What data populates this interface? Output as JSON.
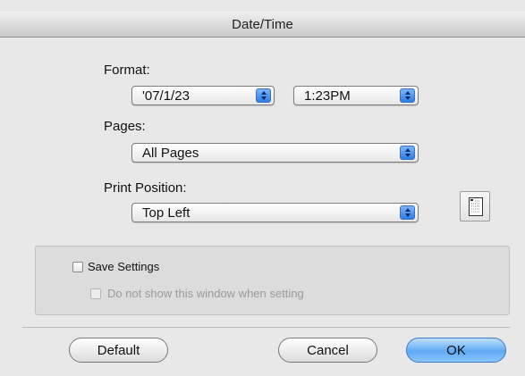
{
  "window": {
    "title": "Date/Time"
  },
  "format": {
    "label": "Format:",
    "date_value": "'07/1/23",
    "time_value": "1:23PM"
  },
  "pages": {
    "label": "Pages:",
    "value": "All Pages"
  },
  "print_position": {
    "label": "Print Position:",
    "value": "Top Left"
  },
  "settings": {
    "save_label": "Save Settings",
    "save_checked": false,
    "dont_show_label": "Do not show this window when setting",
    "dont_show_checked": false,
    "dont_show_enabled": false
  },
  "buttons": {
    "default": "Default",
    "cancel": "Cancel",
    "ok": "OK"
  },
  "colors": {
    "default_button": "#5fa9f3",
    "popup_arrow": "#2e7de6",
    "disabled_text": "#9a9a9a"
  },
  "icons": {
    "popup_arrow": "up-down-arrows-icon",
    "preview": "page-position-preview-icon"
  }
}
